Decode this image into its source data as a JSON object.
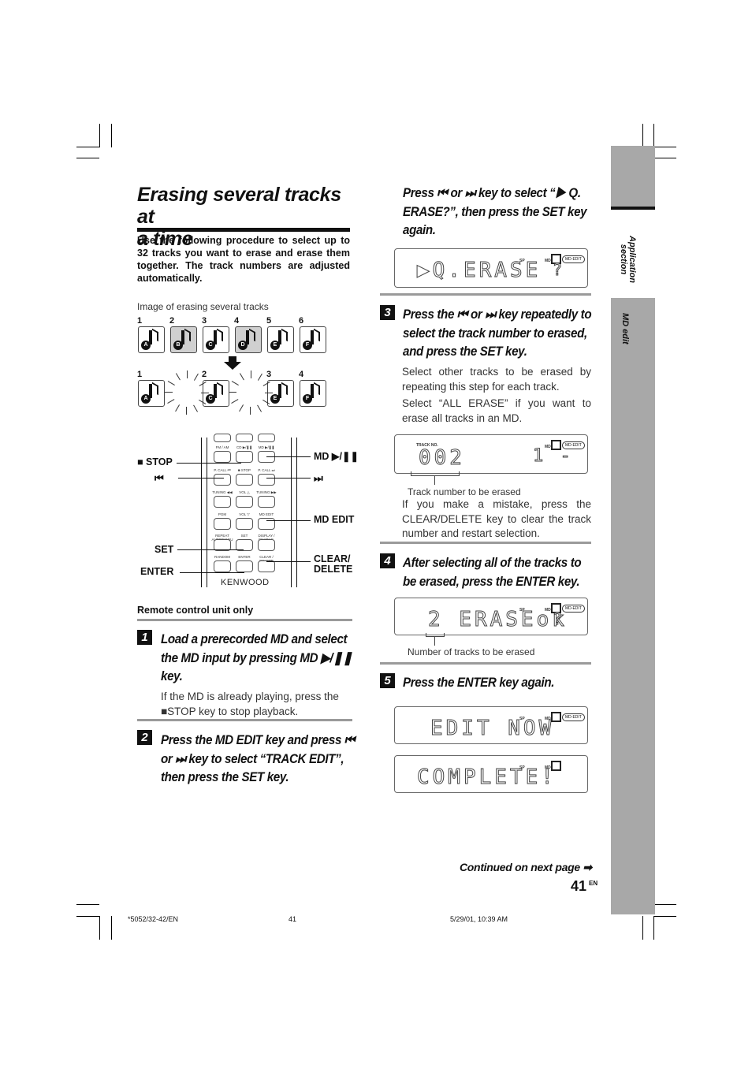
{
  "page": {
    "title": "Erasing several tracks at a time",
    "title_line1": "Erasing several tracks at",
    "title_line2": "a time",
    "intro": "Use the following procedure to select up to 32 tracks you want to erase and erase them together. The track numbers are adjusted automatically.",
    "continued": "Continued on next page ➡",
    "page_number": "41",
    "page_lang": "EN"
  },
  "illustration": {
    "caption": "Image of erasing several tracks",
    "before": [
      {
        "num": "1",
        "letter": "A",
        "selected": false
      },
      {
        "num": "2",
        "letter": "B",
        "selected": true
      },
      {
        "num": "3",
        "letter": "C",
        "selected": false
      },
      {
        "num": "4",
        "letter": "D",
        "selected": true
      },
      {
        "num": "5",
        "letter": "E",
        "selected": false
      },
      {
        "num": "6",
        "letter": "F",
        "selected": false
      }
    ],
    "after": [
      {
        "num": "1",
        "letter": "A"
      },
      {
        "num": "2",
        "letter": "C"
      },
      {
        "num": "3",
        "letter": "E"
      },
      {
        "num": "4",
        "letter": "F"
      }
    ]
  },
  "remote": {
    "brand": "KENWOOD",
    "caption": "Remote control unit only",
    "callouts_left": [
      "■ STOP",
      "⏮",
      "SET",
      "ENTER"
    ],
    "callouts_right": [
      "MD ▶/❚❚",
      "⏭",
      "MD EDIT",
      "CLEAR/",
      "DELETE"
    ],
    "buttons": [
      "FM / AM",
      "CD ▶/❚❚",
      "MD ▶/❚❚",
      "P. CALL ⏮",
      "■ STOP",
      "P. CALL ⏭",
      "TUNING ◀◀",
      "VOL △",
      "TUNING ▶▶",
      "PGM",
      "VOL ▽",
      "MD EDIT",
      "REPEAT AUTO/MANU",
      "SET",
      "DISPLAY / CHARAC.",
      "RANDOM",
      "ENTER",
      "CLEAR / DELETE"
    ]
  },
  "steps": [
    {
      "num": "1",
      "heading": "Load a prerecorded MD and select the MD input by pressing MD ▶/❚❚ key.",
      "body": [
        "If the MD is already playing, press the ■STOP key to stop playback."
      ]
    },
    {
      "num": "2",
      "heading": "Press the MD EDIT key and press ⏮ or ⏭ key to select “TRACK EDIT”, then press the SET key.",
      "body": []
    },
    {
      "num": "",
      "heading": "Press ⏮ or ⏭ key to select “▶ Q. ERASE?”, then press the SET key again.",
      "display": "▶Q.ERASE",
      "body": []
    },
    {
      "num": "3",
      "heading": "Press the ⏮ or ⏭ key repeatedly to select the track number to erased, and press the SET key.",
      "body": [
        "Select other tracks to be erased by repeating this step for each track.",
        "Select “ALL ERASE” if you want to erase all tracks in an MD."
      ],
      "display_label": "TRACK NO.",
      "display": "002",
      "display_right": "1 -",
      "display_caption": "Track number to be erased",
      "note": "If you make a mistake, press the CLEAR/DELETE key to clear the track number and restart selection."
    },
    {
      "num": "4",
      "heading": "After selecting all of the tracks to be erased, press the ENTER key.",
      "display": "2 ERASEok",
      "display_caption": "Number of tracks to be erased",
      "body": []
    },
    {
      "num": "5",
      "heading": "Press the ENTER key again.",
      "displays": [
        "EDIT NOW",
        "COMPLETE!"
      ],
      "body": []
    }
  ],
  "lcd_indicators": {
    "sp": "SP",
    "md": "MD",
    "md_edit": "MD-EDIT",
    "question": "?"
  },
  "side_tab": {
    "section": "Application section",
    "sub": "MD edit"
  },
  "footer": {
    "code": "*5052/32-42/EN",
    "page": "41",
    "datetime": "5/29/01, 10:39 AM"
  }
}
